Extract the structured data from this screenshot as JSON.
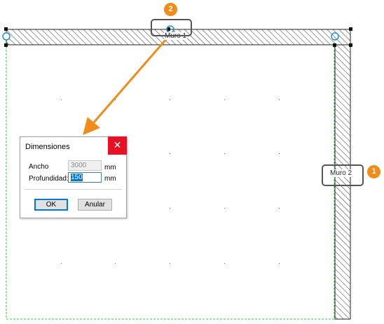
{
  "walls": {
    "top_label": "Muro 1",
    "right_label": "Muro 2"
  },
  "callouts": {
    "badge_1": "1",
    "badge_2": "2"
  },
  "dialog": {
    "title": "Dimensiones",
    "close_glyph": "✕",
    "width_label": "Ancho",
    "width_value": "3000",
    "width_unit": "mm",
    "depth_label": "Profundidad:",
    "depth_value": "150",
    "depth_unit": "mm",
    "ok_label": "OK",
    "cancel_label": "Anular"
  },
  "colors": {
    "accent_orange": "#ef8c1a",
    "close_red": "#e81123",
    "selection_blue": "#0078d7",
    "handle_cyan": "#1e90d0",
    "outline_green": "#2bd12b"
  }
}
